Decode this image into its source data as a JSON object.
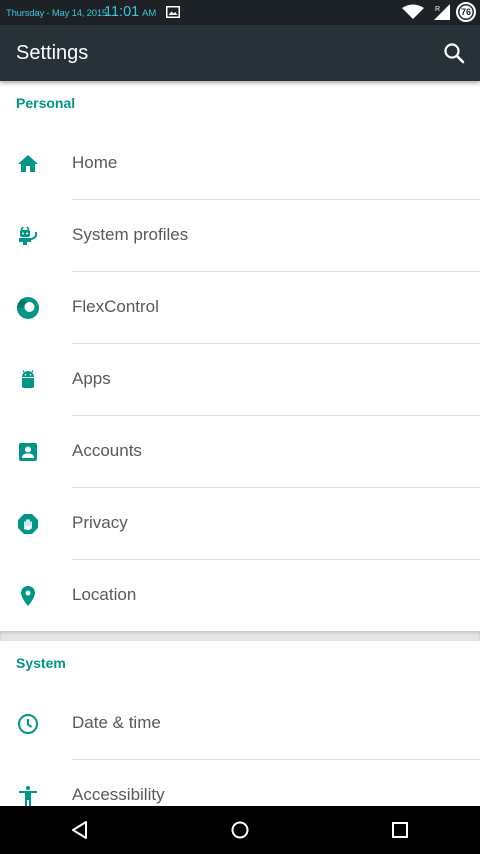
{
  "status_bar": {
    "date": "Thursday - May 14, 2015",
    "time": "11:01",
    "ampm": "AM",
    "battery": "76",
    "colors": {
      "background": "#1c2226",
      "text": "#3fc6d6"
    },
    "icons": [
      "image-notification-icon",
      "wifi-icon",
      "signal-icon",
      "battery-icon"
    ]
  },
  "app_bar": {
    "title": "Settings",
    "search_icon": "search-icon",
    "background": "#263238"
  },
  "sections": {
    "personal": {
      "header": "Personal",
      "items": [
        {
          "label": "Home",
          "icon": "home-icon"
        },
        {
          "label": "System profiles",
          "icon": "profiles-icon"
        },
        {
          "label": "FlexControl",
          "icon": "flexcontrol-icon"
        },
        {
          "label": "Apps",
          "icon": "android-icon"
        },
        {
          "label": "Accounts",
          "icon": "account-box-icon"
        },
        {
          "label": "Privacy",
          "icon": "privacy-hand-icon"
        },
        {
          "label": "Location",
          "icon": "location-pin-icon"
        }
      ]
    },
    "system": {
      "header": "System",
      "items": [
        {
          "label": "Date & time",
          "icon": "clock-icon"
        },
        {
          "label": "Accessibility",
          "icon": "accessibility-icon"
        }
      ]
    }
  },
  "accent_color": "#009688",
  "nav_bar": {
    "icons": [
      "back-icon",
      "home-circle-icon",
      "recents-icon"
    ]
  }
}
